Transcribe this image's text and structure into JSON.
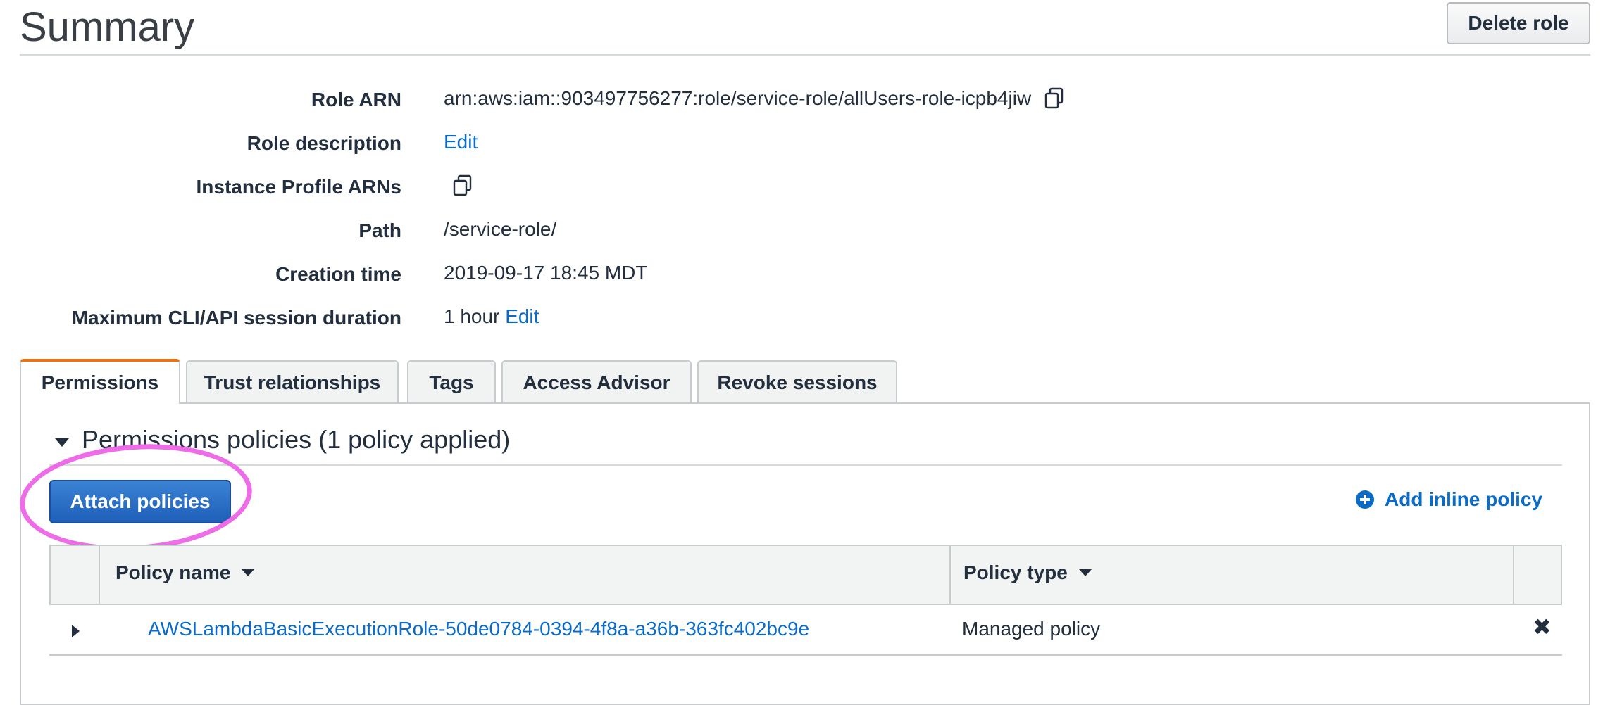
{
  "header": {
    "title": "Summary",
    "delete_label": "Delete role"
  },
  "fields": {
    "role_arn_label": "Role ARN",
    "role_arn_value": "arn:aws:iam::903497756277:role/service-role/allUsers-role-icpb4jiw",
    "role_description_label": "Role description",
    "role_description_edit": "Edit",
    "instance_profile_label": "Instance Profile ARNs",
    "path_label": "Path",
    "path_value": "/service-role/",
    "creation_time_label": "Creation time",
    "creation_time_value": "2019-09-17 18:45 MDT",
    "session_duration_label": "Maximum CLI/API session duration",
    "session_duration_value": "1 hour",
    "session_duration_edit": "Edit"
  },
  "tabs": [
    {
      "label": "Permissions",
      "active": true
    },
    {
      "label": "Trust relationships",
      "active": false
    },
    {
      "label": "Tags",
      "active": false
    },
    {
      "label": "Access Advisor",
      "active": false
    },
    {
      "label": "Revoke sessions",
      "active": false
    }
  ],
  "permissions": {
    "section_title": "Permissions policies (1 policy applied)",
    "attach_label": "Attach policies",
    "inline_label": "Add inline policy",
    "columns": {
      "policy_name": "Policy name",
      "policy_type": "Policy type"
    },
    "rows": [
      {
        "name": "AWSLambdaBasicExecutionRole-50de0784-0394-4f8a-a36b-363fc402bc9e",
        "type": "Managed policy"
      }
    ]
  },
  "colors": {
    "accent_tab": "#ec7211",
    "link": "#0a6bc8",
    "primary_button": "#1e5fb8",
    "highlight": "#ee6ce7"
  },
  "icons": [
    "copy-icon",
    "plus-circle-icon",
    "close-icon",
    "caret-down-icon",
    "caret-right-icon"
  ]
}
